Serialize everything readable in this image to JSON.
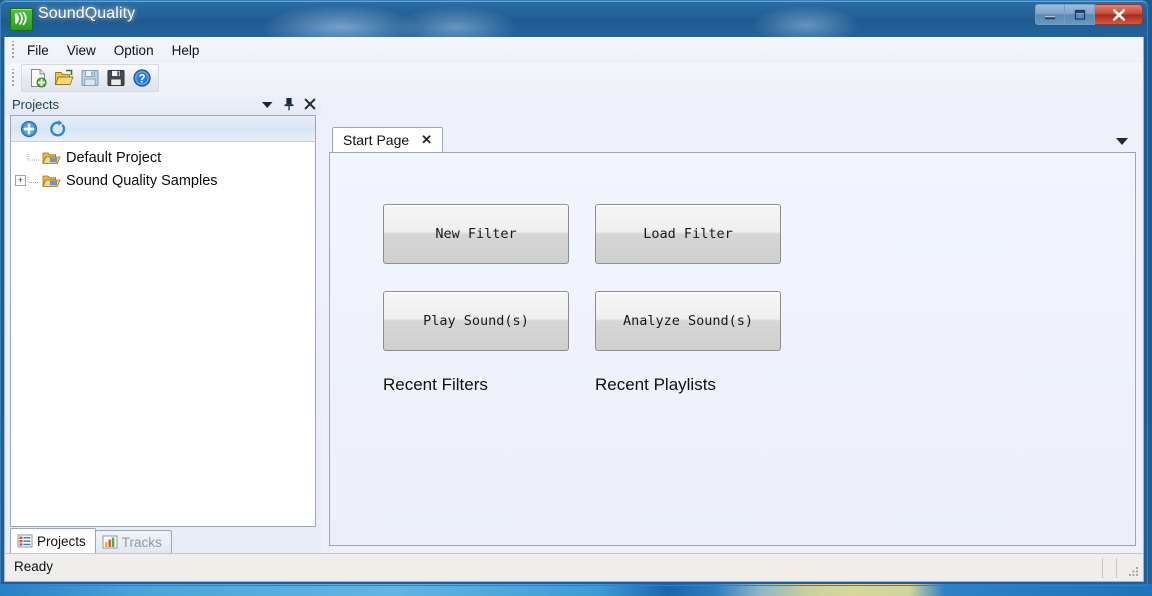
{
  "window": {
    "title": "SoundQuality",
    "app_icon": "sound-wave-icon",
    "controls": {
      "minimize_label": "Minimize",
      "maximize_label": "Maximize",
      "close_label": "Close"
    }
  },
  "menubar": {
    "items": [
      {
        "label": "File"
      },
      {
        "label": "View"
      },
      {
        "label": "Option"
      },
      {
        "label": "Help"
      }
    ]
  },
  "toolbar": {
    "buttons": [
      {
        "name": "new-document-icon",
        "tooltip": "New"
      },
      {
        "name": "open-folder-icon",
        "tooltip": "Open"
      },
      {
        "name": "save-icon",
        "tooltip": "Save"
      },
      {
        "name": "save-all-icon",
        "tooltip": "Save All"
      },
      {
        "name": "help-icon",
        "tooltip": "Help"
      }
    ]
  },
  "dock": {
    "title": "Projects",
    "header_buttons": [
      {
        "name": "dropdown-icon"
      },
      {
        "name": "pin-icon"
      },
      {
        "name": "close-icon"
      }
    ],
    "tree_toolbar": [
      {
        "name": "add-project-icon"
      },
      {
        "name": "refresh-icon"
      }
    ],
    "tree": [
      {
        "label": "Default Project",
        "expandable": false,
        "expander": ""
      },
      {
        "label": "Sound Quality Samples",
        "expandable": true,
        "expander": "+"
      }
    ],
    "tabs": [
      {
        "label": "Projects",
        "active": true,
        "icon": "list-icon"
      },
      {
        "label": "Tracks",
        "active": false,
        "icon": "chart-icon"
      }
    ]
  },
  "document": {
    "tabs": [
      {
        "label": "Start Page",
        "close": "✕"
      }
    ],
    "tablist_icon": "chevron-down-icon",
    "buttons": [
      {
        "label": "New Filter"
      },
      {
        "label": "Load Filter"
      },
      {
        "label": "Play Sound(s)"
      },
      {
        "label": "Analyze Sound(s)"
      }
    ],
    "sections": [
      {
        "label": "Recent Filters"
      },
      {
        "label": "Recent Playlists"
      }
    ]
  },
  "statusbar": {
    "text": "Ready"
  },
  "colors": {
    "titlebar_blue": "#235f95",
    "close_red": "#c9452f",
    "accent_green": "#3fae2e",
    "panel_bg": "#eef1f9",
    "doc_bg": "#f2f5fd"
  }
}
